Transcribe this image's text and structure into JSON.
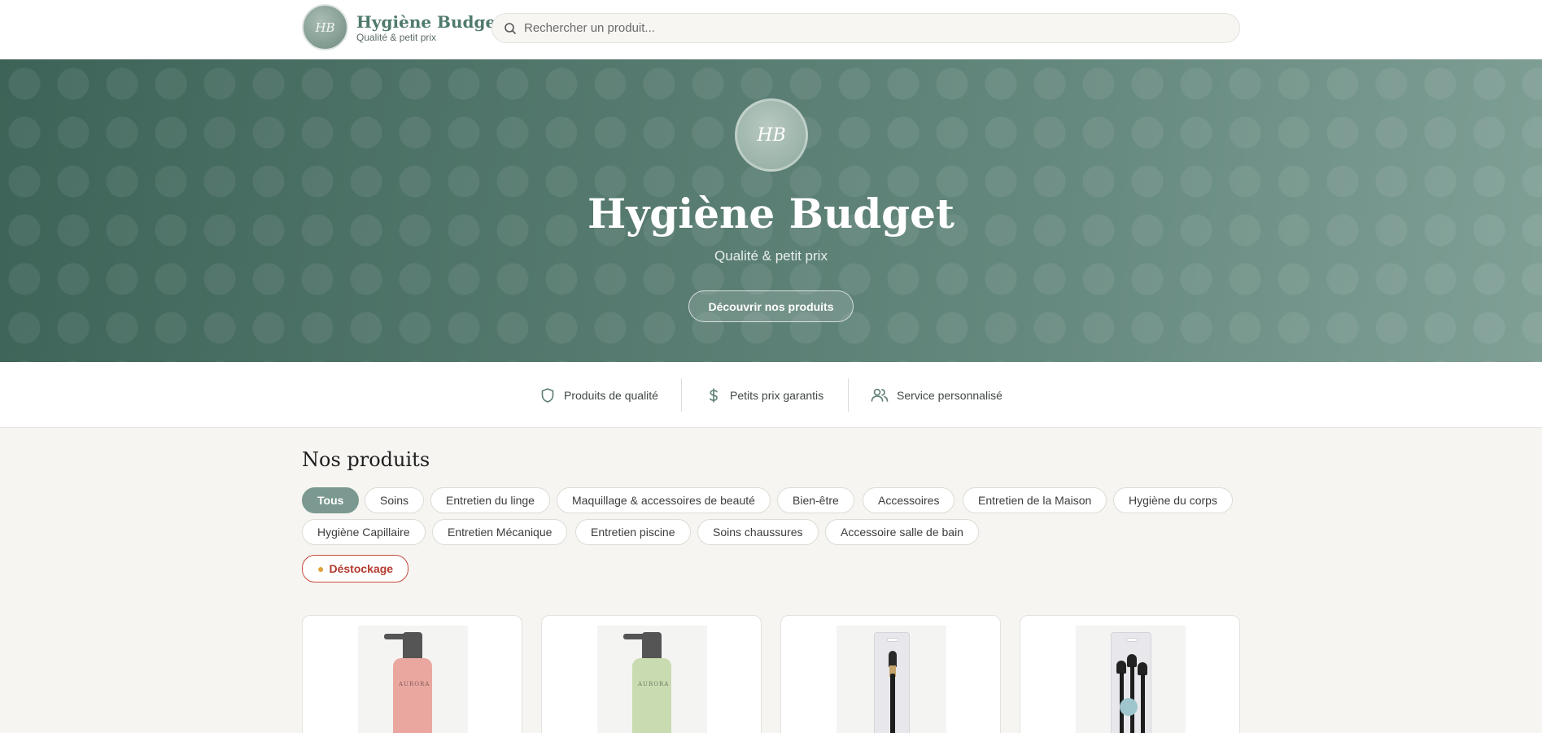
{
  "header": {
    "logo_text": "HB",
    "brand_title": "Hygiène Budget",
    "brand_subtitle": "Qualité & petit prix",
    "search_placeholder": "Rechercher un produit..."
  },
  "hero": {
    "logo_text": "HB",
    "title": "Hygiène Budget",
    "subtitle": "Qualité & petit prix",
    "cta_label": "Découvrir nos produits"
  },
  "features": [
    {
      "label": "Produits de qualité",
      "icon": "shield-icon"
    },
    {
      "label": "Petits prix garantis",
      "icon": "dollar-icon"
    },
    {
      "label": "Service personnalisé",
      "icon": "users-icon"
    }
  ],
  "products": {
    "title": "Nos produits",
    "categories": [
      {
        "label": "Tous",
        "active": true
      },
      {
        "label": "Soins"
      },
      {
        "label": "Entretien du linge"
      },
      {
        "label": "Maquillage & accessoires de beauté"
      },
      {
        "label": "Bien-être"
      },
      {
        "label": "Accessoires"
      },
      {
        "label": "Entretien de la Maison"
      },
      {
        "label": "Hygiène du corps"
      },
      {
        "label": "Hygiène Capillaire"
      },
      {
        "label": "Entretien Mécanique"
      },
      {
        "label": "Entretien piscine"
      },
      {
        "label": "Soins chaussures"
      },
      {
        "label": "Accessoire salle de bain"
      }
    ],
    "destock_label": "Déstockage",
    "items": [
      {
        "kind": "bottle",
        "color": "#e9a7a0",
        "label": "AURORA"
      },
      {
        "kind": "bottle",
        "color": "#c9dbb0",
        "label": "AURORA"
      },
      {
        "kind": "brush"
      },
      {
        "kind": "brush-set"
      }
    ]
  },
  "colors": {
    "accent": "#4f7a6c",
    "chip_active": "#7b9990",
    "destock": "#c64b3e",
    "hero_start": "#3d6358",
    "hero_end": "#80a096"
  }
}
